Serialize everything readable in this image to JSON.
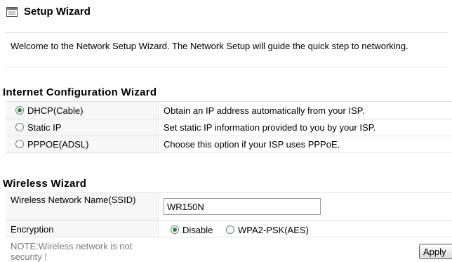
{
  "header": {
    "title": "Setup Wizard",
    "icon": "wizard-page-icon"
  },
  "welcome": {
    "text": "Welcome to the Network Setup Wizard. The Network Setup will guide the quick step to networking."
  },
  "internet": {
    "title": "Internet Configuration Wizard",
    "options": [
      {
        "label": "DHCP(Cable)",
        "description": "Obtain an IP address automatically from your ISP.",
        "selected": true
      },
      {
        "label": "Static IP",
        "description": "Set static IP information provided to you by your ISP.",
        "selected": false
      },
      {
        "label": "PPPOE(ADSL)",
        "description": "Choose this option if your ISP uses PPPoE.",
        "selected": false
      }
    ]
  },
  "wireless": {
    "title": "Wireless Wizard",
    "ssid_label": "Wireless Network Name(SSID)",
    "ssid_value": "WR150N",
    "encryption_label": "Encryption",
    "encryption_options": [
      {
        "label": "Disable",
        "selected": true
      },
      {
        "label": "WPA2-PSK(AES)",
        "selected": false
      }
    ],
    "note": "NOTE:Wireless network is not security !",
    "apply_label": "Apply"
  },
  "colors": {
    "radio_dot": "#1c8e24",
    "divider": "#e4e4e4",
    "label_bg": "#f7f7f7",
    "note_text": "#7a7a7a"
  }
}
